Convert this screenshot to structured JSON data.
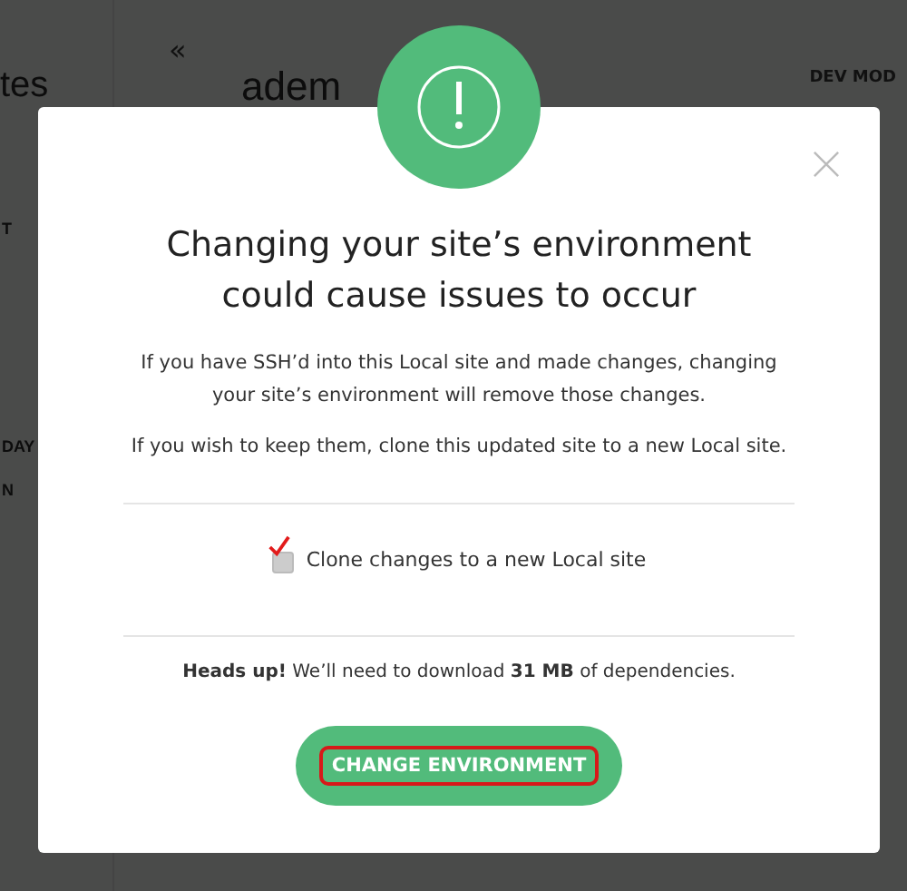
{
  "background": {
    "sidebar_title": "tes",
    "sidebar_items": [
      "T",
      "DAY",
      "N"
    ],
    "collapse": "«",
    "site_title": "adem",
    "mode_label": "DEV MOD"
  },
  "modal": {
    "title": "Changing your site’s environment could cause issues to occur",
    "paragraphs": [
      "If you have SSH’d into this Local site and made changes, changing your site’s environment will remove those changes.",
      "If you wish to keep them, clone this updated site to a new Local site."
    ],
    "checkbox": {
      "label": "Clone changes to a new Local site",
      "checked": true
    },
    "notice": "**Heads up!** We’ll need to download **31 MB** of dependencies.",
    "button": "CHANGE ENVIRONMENT"
  }
}
